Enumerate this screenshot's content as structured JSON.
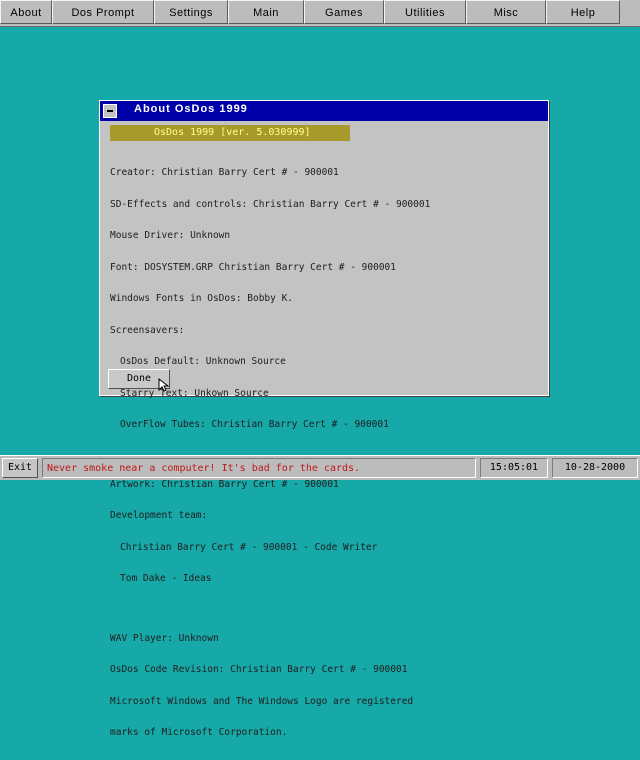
{
  "menubar": {
    "items": [
      "About",
      "Dos Prompt",
      "Settings",
      "Main",
      "Games",
      "Utilities",
      "Misc",
      "Help"
    ]
  },
  "dialog": {
    "title": "About OsDos 1999",
    "version": "OsDos 1999 [ver. 5.030999]",
    "credits": {
      "creator": "Creator: Christian Barry Cert # - 900001",
      "sd": "SD-Effects and controls: Christian Barry Cert # - 900001",
      "mouse": "Mouse Driver: Unknown",
      "font": "Font: DOSYSTEM.GRP Christian Barry Cert # - 900001",
      "windows_fonts": "Windows Fonts in OsDos: Bobby K.",
      "screensavers": "Screensavers:",
      "ss1": "OsDos Default: Unknown Source",
      "ss2": "Starry Text: Unkown Source",
      "ss3": "OverFlow Tubes: Christian Barry Cert # - 900001",
      "artwork": "Artwork: Christian Barry Cert # - 900001",
      "dev_team": "Development team:",
      "dev1": "Christian Barry Cert # - 900001 - Code Writer",
      "dev2": "Tom Dake - Ideas",
      "wav": "WAV Player: Unknown",
      "revision": "OsDos Code Revision: Christian Barry Cert # - 900001",
      "ms1": "Microsoft Windows and The Windows Logo are registered",
      "ms2": "marks of Microsoft Corporation."
    },
    "done_label": "Done"
  },
  "statusbar": {
    "exit_label": "Exit",
    "ticker": "Never smoke near a computer! It's bad for the cards.",
    "clock": "15:05:01",
    "date": "10-28-2000"
  },
  "colors": {
    "desktop": "#17a8a8",
    "titlebar": "#0000a8",
    "ticker_text": "#c01818"
  }
}
